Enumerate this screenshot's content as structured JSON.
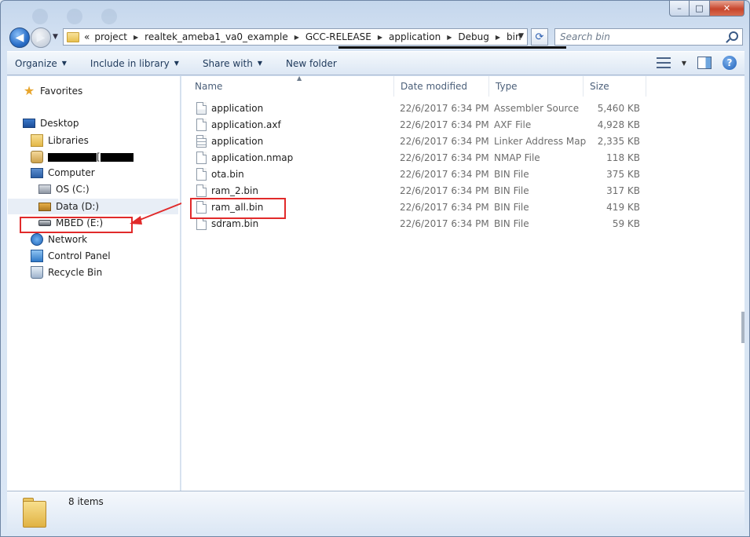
{
  "window": {
    "min_glyph": "–",
    "max_glyph": "□",
    "close_glyph": "✕"
  },
  "nav": {
    "back_glyph": "◀",
    "forward_glyph": "▶",
    "drop_glyph": "▼"
  },
  "address": {
    "overflow": "«",
    "crumbs": [
      "project",
      "realtek_ameba1_va0_example",
      "GCC-RELEASE",
      "application",
      "Debug",
      "bin"
    ],
    "sep_glyph": "▶",
    "drop_glyph": "▼",
    "refresh_glyph": "⟳"
  },
  "search": {
    "placeholder": "Search bin"
  },
  "toolbar": {
    "organize": "Organize",
    "include_in_library": "Include in library",
    "share_with": "Share with",
    "new_folder": "New folder",
    "caret": "▼",
    "help": "?"
  },
  "sidebar": {
    "favorites": "Favorites",
    "desktop": "Desktop",
    "libraries": "Libraries",
    "user_suffix": "[",
    "computer": "Computer",
    "os_c": "OS (C:)",
    "data_d": "Data (D:)",
    "mbed_e": "MBED (E:)",
    "network": "Network",
    "control_panel": "Control Panel",
    "recycle_bin": "Recycle Bin"
  },
  "columns": {
    "name": "Name",
    "date_modified": "Date modified",
    "type": "Type",
    "size": "Size",
    "sort_glyph": "▲"
  },
  "files": [
    {
      "name": "application",
      "date": "22/6/2017 6:34 PM",
      "type": "Assembler Source",
      "size": "5,460 KB",
      "icon": "asm-file-icon"
    },
    {
      "name": "application.axf",
      "date": "22/6/2017 6:34 PM",
      "type": "AXF File",
      "size": "4,928 KB",
      "icon": "file-icon"
    },
    {
      "name": "application",
      "date": "22/6/2017 6:34 PM",
      "type": "Linker Address Map",
      "size": "2,335 KB",
      "icon": "map-file-icon"
    },
    {
      "name": "application.nmap",
      "date": "22/6/2017 6:34 PM",
      "type": "NMAP File",
      "size": "118 KB",
      "icon": "file-icon"
    },
    {
      "name": "ota.bin",
      "date": "22/6/2017 6:34 PM",
      "type": "BIN File",
      "size": "375 KB",
      "icon": "file-icon"
    },
    {
      "name": "ram_2.bin",
      "date": "22/6/2017 6:34 PM",
      "type": "BIN File",
      "size": "317 KB",
      "icon": "file-icon"
    },
    {
      "name": "ram_all.bin",
      "date": "22/6/2017 6:34 PM",
      "type": "BIN File",
      "size": "419 KB",
      "icon": "file-icon"
    },
    {
      "name": "sdram.bin",
      "date": "22/6/2017 6:34 PM",
      "type": "BIN File",
      "size": "59 KB",
      "icon": "file-icon"
    }
  ],
  "status": {
    "item_count": "8 items"
  },
  "colors": {
    "highlight_red": "#e12a2a",
    "nav_selected_bg": "#e8eef6"
  }
}
